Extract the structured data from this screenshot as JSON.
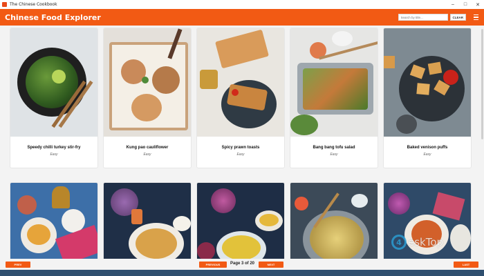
{
  "window": {
    "title": "The Chinese Cookbook",
    "controls": [
      "–",
      "□",
      "✕"
    ]
  },
  "header": {
    "brand": "Chinese Food Explorer",
    "search_placeholder": "Search by title...",
    "clear_label": "CLEAR",
    "menu_icon": "hamburger-icon",
    "accent": "#f25a14"
  },
  "recipes_row1": [
    {
      "name": "Speedy chilli turkey stir-fry",
      "level": "Easy"
    },
    {
      "name": "Kung pao cauliflower",
      "level": "Easy"
    },
    {
      "name": "Spicy prawn toasts",
      "level": "Easy"
    },
    {
      "name": "Bang bang tofu salad",
      "level": "Easy"
    },
    {
      "name": "Baked venison puffs",
      "level": "Easy"
    }
  ],
  "footer": {
    "prev": "PREV",
    "previous": "PREVIOUS",
    "page_text": "Page 3 of 20",
    "next": "NEXT",
    "last": "LAST"
  },
  "watermark": "4eskTop"
}
